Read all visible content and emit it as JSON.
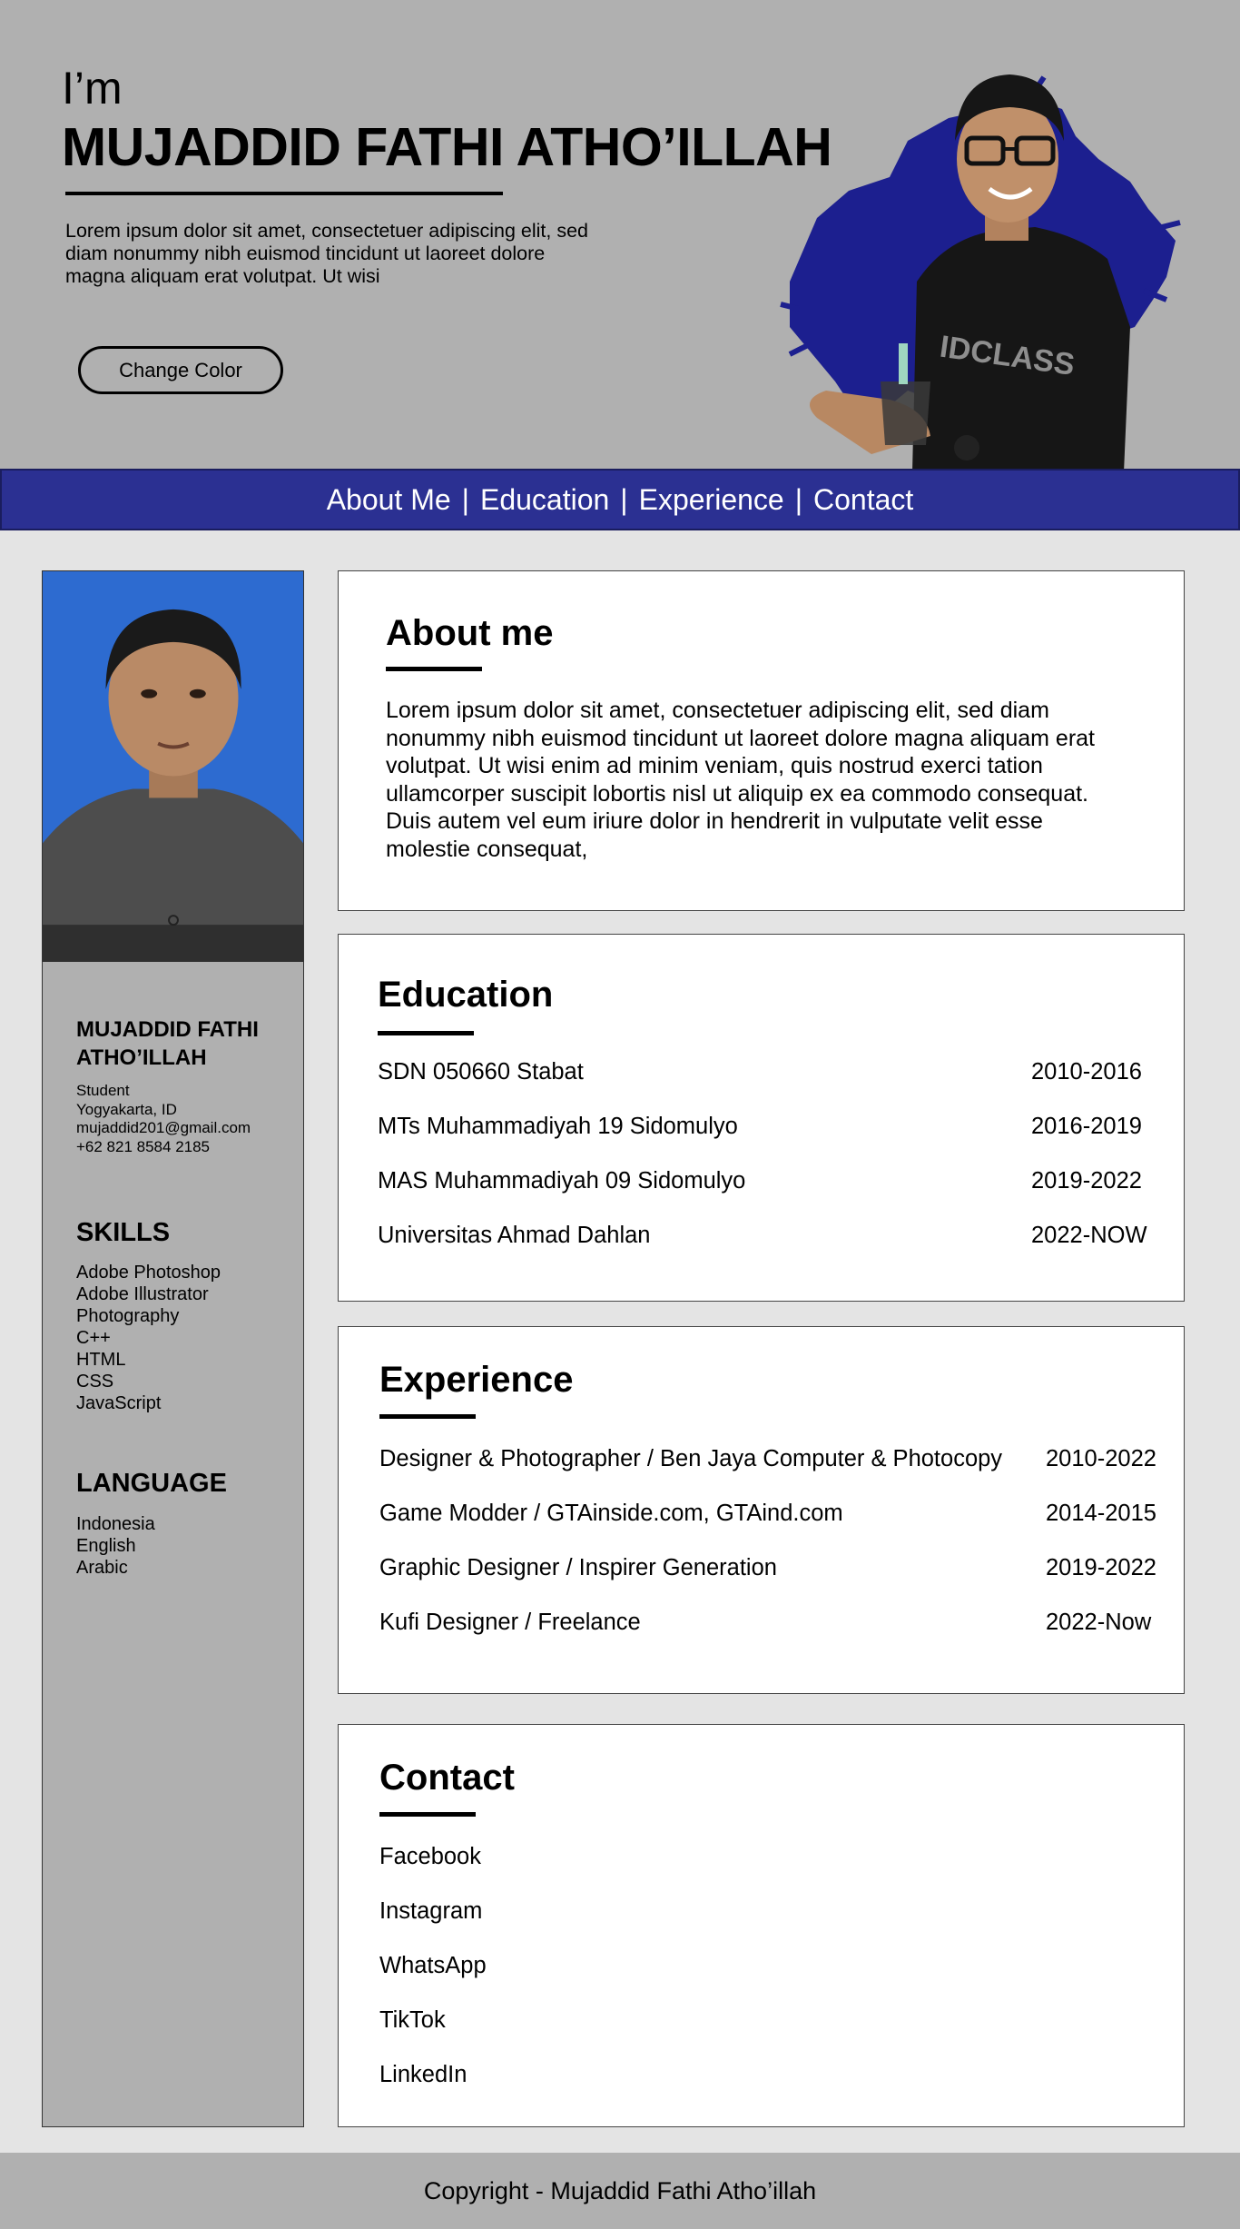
{
  "hero": {
    "greeting": "I’m",
    "name": "MUJADDID FATHI ATHO’ILLAH",
    "intro": "Lorem ipsum dolor sit amet, consectetuer adipiscing elit, sed diam nonummy nibh euismod tincidunt ut laoreet dolore magna aliquam erat volutpat. Ut wisi",
    "button_label": "Change Color"
  },
  "nav": {
    "items": [
      "About Me",
      "Education",
      "Experience",
      "Contact"
    ],
    "separator": "|"
  },
  "sidebar": {
    "name": "MUJADDID FATHI ATHO’ILLAH",
    "info": [
      "Student",
      "Yogyakarta, ID",
      "mujaddid201@gmail.com",
      "+62 821 8584 2185"
    ],
    "skills_heading": "SKILLS",
    "skills": [
      "Adobe Photoshop",
      "Adobe Illustrator",
      "Photography",
      "C++",
      "HTML",
      "CSS",
      "JavaScript"
    ],
    "language_heading": "LANGUAGE",
    "languages": [
      "Indonesia",
      "English",
      "Arabic"
    ]
  },
  "about": {
    "title": "About me",
    "text": "Lorem ipsum dolor sit amet, consectetuer adipiscing elit, sed diam nonummy nibh euismod tincidunt ut laoreet dolore magna aliquam erat volutpat. Ut wisi enim ad minim veniam, quis nostrud exerci tation ullamcorper suscipit lobortis nisl ut aliquip ex ea commodo consequat. Duis autem vel eum iriure dolor in hendrerit in vulputate velit esse molestie consequat,"
  },
  "education": {
    "title": "Education",
    "items": [
      {
        "name": "SDN 050660 Stabat",
        "years": "2010-2016"
      },
      {
        "name": "MTs Muhammadiyah 19 Sidomulyo",
        "years": "2016-2019"
      },
      {
        "name": "MAS Muhammadiyah 09 Sidomulyo",
        "years": "2019-2022"
      },
      {
        "name": "Universitas Ahmad Dahlan",
        "years": "2022-NOW"
      }
    ]
  },
  "experience": {
    "title": "Experience",
    "items": [
      {
        "name": "Designer & Photographer / Ben Jaya Computer & Photocopy",
        "years": "2010-2022"
      },
      {
        "name": "Game Modder / GTAinside.com, GTAind.com",
        "years": "2014-2015"
      },
      {
        "name": "Graphic Designer / Inspirer Generation",
        "years": "2019-2022"
      },
      {
        "name": "Kufi Designer / Freelance",
        "years": "2022-Now"
      }
    ]
  },
  "contact": {
    "title": "Contact",
    "items": [
      "Facebook",
      "Instagram",
      "WhatsApp",
      "TikTok",
      "LinkedIn"
    ]
  },
  "footer": {
    "text": "Copyright - Mujaddid Fathi Atho’illah"
  },
  "colors": {
    "hero_bg": "#b0b0b0",
    "nav_bg": "#2b3092",
    "page_bg": "#e4e4e4",
    "brush": "#1c1f8f",
    "photo_bg": "#2d6bd0"
  },
  "icons": {
    "hero_portrait": "portrait-photo-with-brush-stroke",
    "profile_photo": "profile-photo"
  }
}
